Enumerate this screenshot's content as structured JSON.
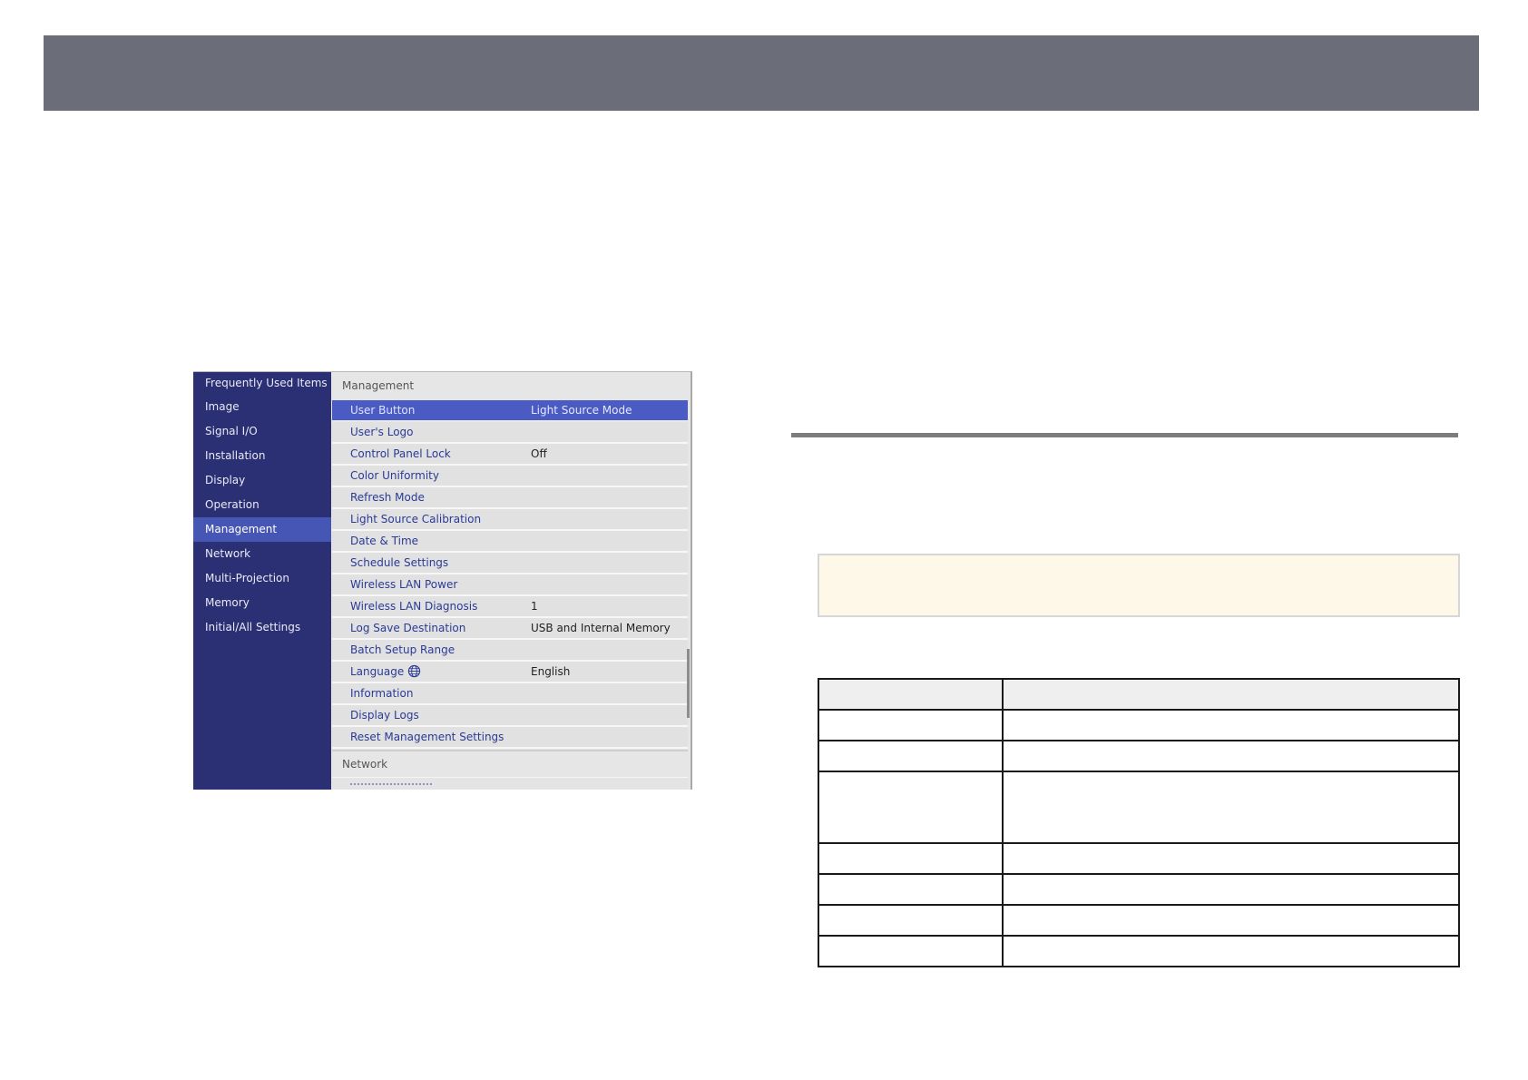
{
  "menu": {
    "nav_items": [
      {
        "label": "Frequently Used Items"
      },
      {
        "label": "Image"
      },
      {
        "label": "Signal I/O"
      },
      {
        "label": "Installation"
      },
      {
        "label": "Display"
      },
      {
        "label": "Operation"
      },
      {
        "label": "Management"
      },
      {
        "label": "Network"
      },
      {
        "label": "Multi-Projection"
      },
      {
        "label": "Memory"
      },
      {
        "label": "Initial/All Settings"
      }
    ],
    "active_nav": "Management",
    "section_title": "Management",
    "rows": [
      {
        "label": "User Button",
        "value": "Light Source Mode"
      },
      {
        "label": "User's Logo",
        "value": ""
      },
      {
        "label": "Control Panel Lock",
        "value": "Off"
      },
      {
        "label": "Color Uniformity",
        "value": ""
      },
      {
        "label": "Refresh Mode",
        "value": ""
      },
      {
        "label": "Light Source Calibration",
        "value": ""
      },
      {
        "label": "Date & Time",
        "value": ""
      },
      {
        "label": "Schedule Settings",
        "value": ""
      },
      {
        "label": "Wireless LAN Power",
        "value": ""
      },
      {
        "label": "Wireless LAN Diagnosis",
        "value": "1"
      },
      {
        "label": "Log Save Destination",
        "value": "USB and Internal Memory"
      },
      {
        "label": "Batch Setup Range",
        "value": ""
      },
      {
        "label": "Language",
        "value": "English",
        "icon": "globe-icon"
      },
      {
        "label": "Information",
        "value": ""
      },
      {
        "label": "Display Logs",
        "value": ""
      },
      {
        "label": "Reset Management Settings",
        "value": ""
      }
    ],
    "selected_row": "User Button",
    "next_section_title": "Network"
  },
  "colors": {
    "header_bar": "#6b6e78",
    "menu_nav_bg": "#2b3074",
    "menu_nav_active": "#4656b4",
    "menu_row_selected": "#4a5bc3",
    "note_box_bg": "#fdf8e7"
  }
}
